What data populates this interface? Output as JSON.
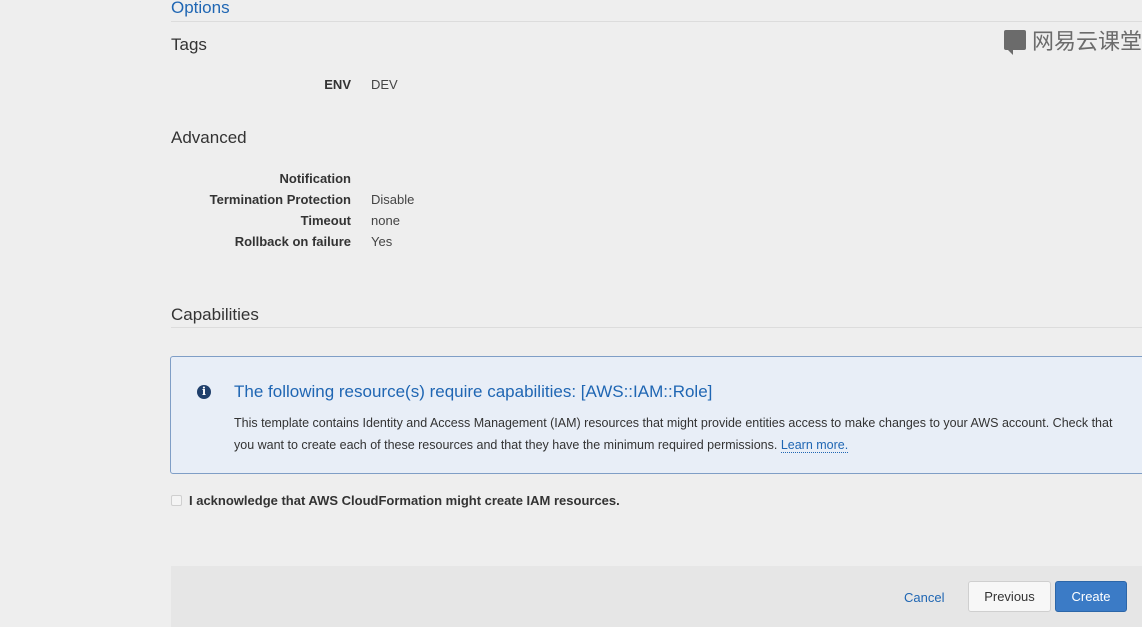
{
  "options_title": "Options",
  "watermark": {
    "text": "网易云课堂",
    "icon": "chat-bubble-icon"
  },
  "tags": {
    "title": "Tags",
    "rows": [
      {
        "key": "ENV",
        "value": "DEV"
      }
    ]
  },
  "advanced": {
    "title": "Advanced",
    "rows": [
      {
        "key": "Notification",
        "value": ""
      },
      {
        "key": "Termination Protection",
        "value": "Disable"
      },
      {
        "key": "Timeout",
        "value": "none"
      },
      {
        "key": "Rollback on failure",
        "value": "Yes"
      }
    ]
  },
  "capabilities": {
    "title": "Capabilities",
    "info": {
      "icon": "info-icon",
      "title": "The following resource(s) require capabilities: [AWS::IAM::Role]",
      "body": "This template contains Identity and Access Management (IAM) resources that might provide entities access to make changes to your AWS account. Check that you want to create each of these resources and that they have the minimum required permissions.",
      "link": "Learn more."
    },
    "acknowledge": {
      "label": "I acknowledge that AWS CloudFormation might create IAM resources.",
      "checked": false
    }
  },
  "footer": {
    "cancel": "Cancel",
    "previous": "Previous",
    "create": "Create"
  },
  "colors": {
    "link": "#1f66b3",
    "primary_button": "#3b7bc6",
    "info_border": "#7f9ec6",
    "info_bg": "#e8eef7"
  }
}
